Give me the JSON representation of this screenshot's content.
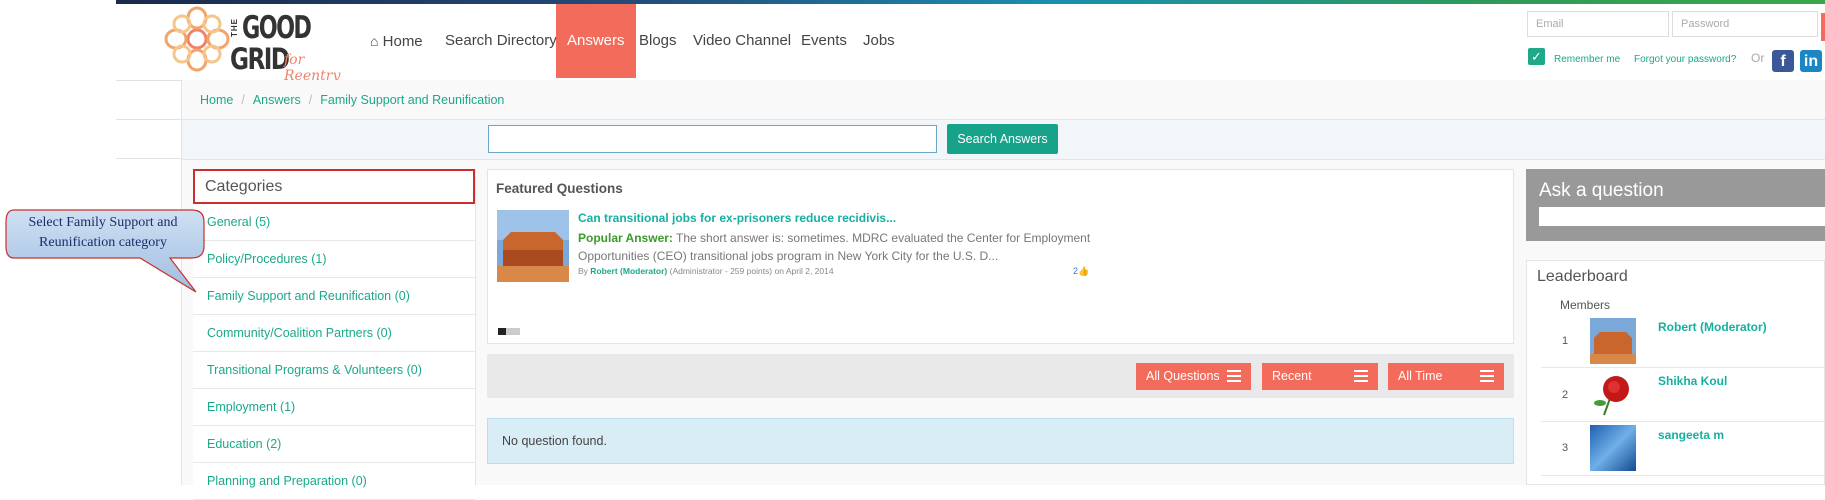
{
  "logo": {
    "the": "THE",
    "good": "GOOD",
    "grid": "GRID",
    "tagline": "for Reentry"
  },
  "nav": {
    "home": "Home",
    "search_directory": "Search Directory",
    "answers": "Answers",
    "blogs": "Blogs",
    "video_channel": "Video Channel",
    "events": "Events",
    "jobs": "Jobs"
  },
  "login": {
    "email_placeholder": "Email",
    "password_placeholder": "Password",
    "remember_me": "Remember me",
    "forgot_password": "Forgot your password?",
    "or": "Or"
  },
  "breadcrumb": {
    "home": "Home",
    "answers": "Answers",
    "current": "Family Support and Reunification"
  },
  "search": {
    "button_label": "Search Answers"
  },
  "categories": {
    "title": "Categories",
    "items": [
      "General (5)",
      "Policy/Procedures (1)",
      "Family Support and Reunification (0)",
      "Community/Coalition Partners (0)",
      "Transitional Programs & Volunteers (0)",
      "Employment (1)",
      "Education (2)",
      "Planning and Preparation (0)"
    ]
  },
  "callout": {
    "text": "Select Family Support and Reunification category"
  },
  "featured": {
    "title": "Featured Questions",
    "question": "Can transitional jobs for ex-prisoners reduce recidivis...",
    "answer_label": "Popular Answer:",
    "answer_text": " The short answer is: sometimes. MDRC evaluated the Center for Employment Opportunities (CEO) transitional jobs program in New York City for the U.S. D...",
    "by": "By ",
    "author": "Robert (Moderator)",
    "author_meta": "  (Administrator - 259 points)   on April 2, 2014",
    "likes": "2"
  },
  "filters": {
    "all_questions": "All Questions",
    "recent": "Recent",
    "all_time": "All Time"
  },
  "no_questions": "No question found.",
  "ask": {
    "title": "Ask a question"
  },
  "leaderboard": {
    "title": "Leaderboard",
    "members_label": "Members",
    "rows": [
      {
        "rank": "1",
        "name": "Robert (Moderator)"
      },
      {
        "rank": "2",
        "name": "Shikha Koul"
      },
      {
        "rank": "3",
        "name": "sangeeta m"
      }
    ]
  },
  "colors": {
    "accent": "#f26b5b",
    "link": "#1aa98a",
    "button": "#16a38a"
  }
}
